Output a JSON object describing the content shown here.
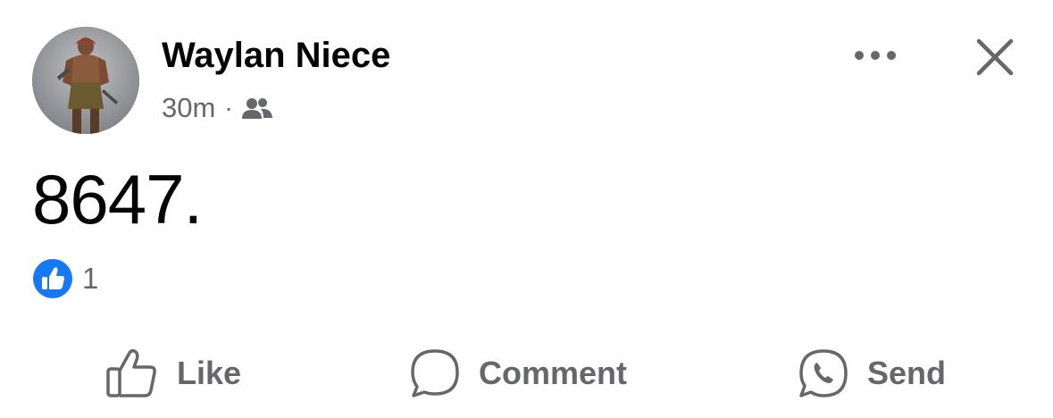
{
  "post": {
    "author": "Waylan Niece",
    "time": "30m",
    "separator": "·",
    "audience_icon": "friends-icon",
    "text": "8647.",
    "reactions": {
      "icon": "like-reaction-icon",
      "count": "1"
    },
    "header_actions": [
      "more-options-icon",
      "close-icon"
    ]
  },
  "actions": {
    "like": "Like",
    "comment": "Comment",
    "send": "Send"
  },
  "colors": {
    "text_primary": "#050505",
    "text_secondary": "#65676b",
    "like_blue": "#1877f2",
    "background": "#ffffff"
  }
}
